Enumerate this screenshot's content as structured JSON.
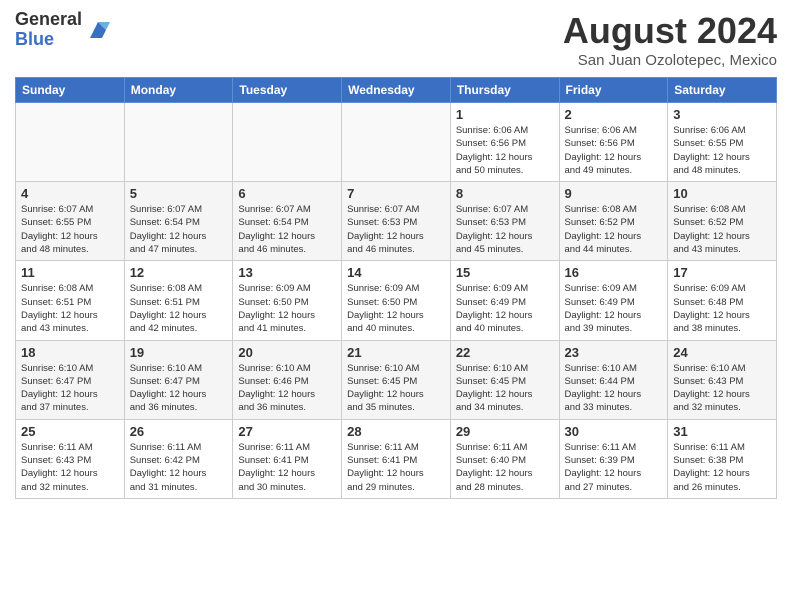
{
  "logo": {
    "general": "General",
    "blue": "Blue"
  },
  "title": "August 2024",
  "location": "San Juan Ozolotepec, Mexico",
  "weekdays": [
    "Sunday",
    "Monday",
    "Tuesday",
    "Wednesday",
    "Thursday",
    "Friday",
    "Saturday"
  ],
  "weeks": [
    [
      {
        "num": "",
        "info": ""
      },
      {
        "num": "",
        "info": ""
      },
      {
        "num": "",
        "info": ""
      },
      {
        "num": "",
        "info": ""
      },
      {
        "num": "1",
        "info": "Sunrise: 6:06 AM\nSunset: 6:56 PM\nDaylight: 12 hours\nand 50 minutes."
      },
      {
        "num": "2",
        "info": "Sunrise: 6:06 AM\nSunset: 6:56 PM\nDaylight: 12 hours\nand 49 minutes."
      },
      {
        "num": "3",
        "info": "Sunrise: 6:06 AM\nSunset: 6:55 PM\nDaylight: 12 hours\nand 48 minutes."
      }
    ],
    [
      {
        "num": "4",
        "info": "Sunrise: 6:07 AM\nSunset: 6:55 PM\nDaylight: 12 hours\nand 48 minutes."
      },
      {
        "num": "5",
        "info": "Sunrise: 6:07 AM\nSunset: 6:54 PM\nDaylight: 12 hours\nand 47 minutes."
      },
      {
        "num": "6",
        "info": "Sunrise: 6:07 AM\nSunset: 6:54 PM\nDaylight: 12 hours\nand 46 minutes."
      },
      {
        "num": "7",
        "info": "Sunrise: 6:07 AM\nSunset: 6:53 PM\nDaylight: 12 hours\nand 46 minutes."
      },
      {
        "num": "8",
        "info": "Sunrise: 6:07 AM\nSunset: 6:53 PM\nDaylight: 12 hours\nand 45 minutes."
      },
      {
        "num": "9",
        "info": "Sunrise: 6:08 AM\nSunset: 6:52 PM\nDaylight: 12 hours\nand 44 minutes."
      },
      {
        "num": "10",
        "info": "Sunrise: 6:08 AM\nSunset: 6:52 PM\nDaylight: 12 hours\nand 43 minutes."
      }
    ],
    [
      {
        "num": "11",
        "info": "Sunrise: 6:08 AM\nSunset: 6:51 PM\nDaylight: 12 hours\nand 43 minutes."
      },
      {
        "num": "12",
        "info": "Sunrise: 6:08 AM\nSunset: 6:51 PM\nDaylight: 12 hours\nand 42 minutes."
      },
      {
        "num": "13",
        "info": "Sunrise: 6:09 AM\nSunset: 6:50 PM\nDaylight: 12 hours\nand 41 minutes."
      },
      {
        "num": "14",
        "info": "Sunrise: 6:09 AM\nSunset: 6:50 PM\nDaylight: 12 hours\nand 40 minutes."
      },
      {
        "num": "15",
        "info": "Sunrise: 6:09 AM\nSunset: 6:49 PM\nDaylight: 12 hours\nand 40 minutes."
      },
      {
        "num": "16",
        "info": "Sunrise: 6:09 AM\nSunset: 6:49 PM\nDaylight: 12 hours\nand 39 minutes."
      },
      {
        "num": "17",
        "info": "Sunrise: 6:09 AM\nSunset: 6:48 PM\nDaylight: 12 hours\nand 38 minutes."
      }
    ],
    [
      {
        "num": "18",
        "info": "Sunrise: 6:10 AM\nSunset: 6:47 PM\nDaylight: 12 hours\nand 37 minutes."
      },
      {
        "num": "19",
        "info": "Sunrise: 6:10 AM\nSunset: 6:47 PM\nDaylight: 12 hours\nand 36 minutes."
      },
      {
        "num": "20",
        "info": "Sunrise: 6:10 AM\nSunset: 6:46 PM\nDaylight: 12 hours\nand 36 minutes."
      },
      {
        "num": "21",
        "info": "Sunrise: 6:10 AM\nSunset: 6:45 PM\nDaylight: 12 hours\nand 35 minutes."
      },
      {
        "num": "22",
        "info": "Sunrise: 6:10 AM\nSunset: 6:45 PM\nDaylight: 12 hours\nand 34 minutes."
      },
      {
        "num": "23",
        "info": "Sunrise: 6:10 AM\nSunset: 6:44 PM\nDaylight: 12 hours\nand 33 minutes."
      },
      {
        "num": "24",
        "info": "Sunrise: 6:10 AM\nSunset: 6:43 PM\nDaylight: 12 hours\nand 32 minutes."
      }
    ],
    [
      {
        "num": "25",
        "info": "Sunrise: 6:11 AM\nSunset: 6:43 PM\nDaylight: 12 hours\nand 32 minutes."
      },
      {
        "num": "26",
        "info": "Sunrise: 6:11 AM\nSunset: 6:42 PM\nDaylight: 12 hours\nand 31 minutes."
      },
      {
        "num": "27",
        "info": "Sunrise: 6:11 AM\nSunset: 6:41 PM\nDaylight: 12 hours\nand 30 minutes."
      },
      {
        "num": "28",
        "info": "Sunrise: 6:11 AM\nSunset: 6:41 PM\nDaylight: 12 hours\nand 29 minutes."
      },
      {
        "num": "29",
        "info": "Sunrise: 6:11 AM\nSunset: 6:40 PM\nDaylight: 12 hours\nand 28 minutes."
      },
      {
        "num": "30",
        "info": "Sunrise: 6:11 AM\nSunset: 6:39 PM\nDaylight: 12 hours\nand 27 minutes."
      },
      {
        "num": "31",
        "info": "Sunrise: 6:11 AM\nSunset: 6:38 PM\nDaylight: 12 hours\nand 26 minutes."
      }
    ]
  ]
}
